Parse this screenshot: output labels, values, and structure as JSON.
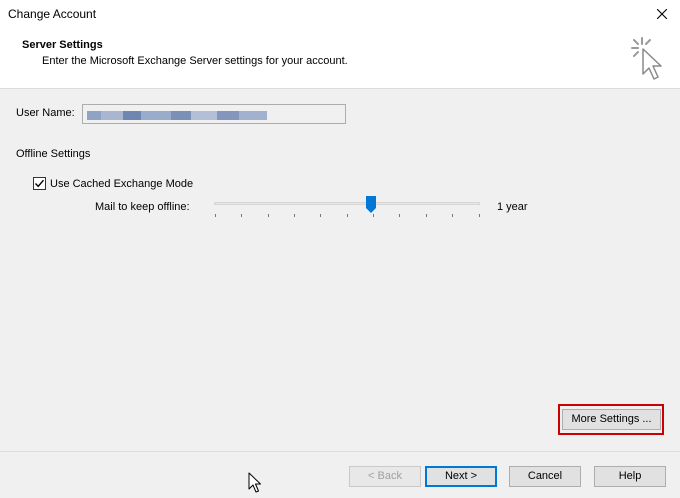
{
  "window": {
    "title": "Change Account"
  },
  "header": {
    "title": "Server Settings",
    "subtitle": "Enter the Microsoft Exchange Server settings for your account.",
    "icon": "cursor-click-icon"
  },
  "user": {
    "label": "User Name:",
    "value_redacted": true
  },
  "offline": {
    "section_label": "Offline Settings",
    "cached_mode_label": "Use Cached Exchange Mode",
    "cached_mode_checked": true,
    "mail_keep_label": "Mail to keep offline:",
    "mail_keep_value": "1 year",
    "slider_position_fraction": 0.59
  },
  "buttons": {
    "more_settings": "More Settings ...",
    "back": "< Back",
    "next": "Next >",
    "cancel": "Cancel",
    "help": "Help"
  },
  "colors": {
    "accent": "#0078d7",
    "highlight": "#cc0000"
  }
}
